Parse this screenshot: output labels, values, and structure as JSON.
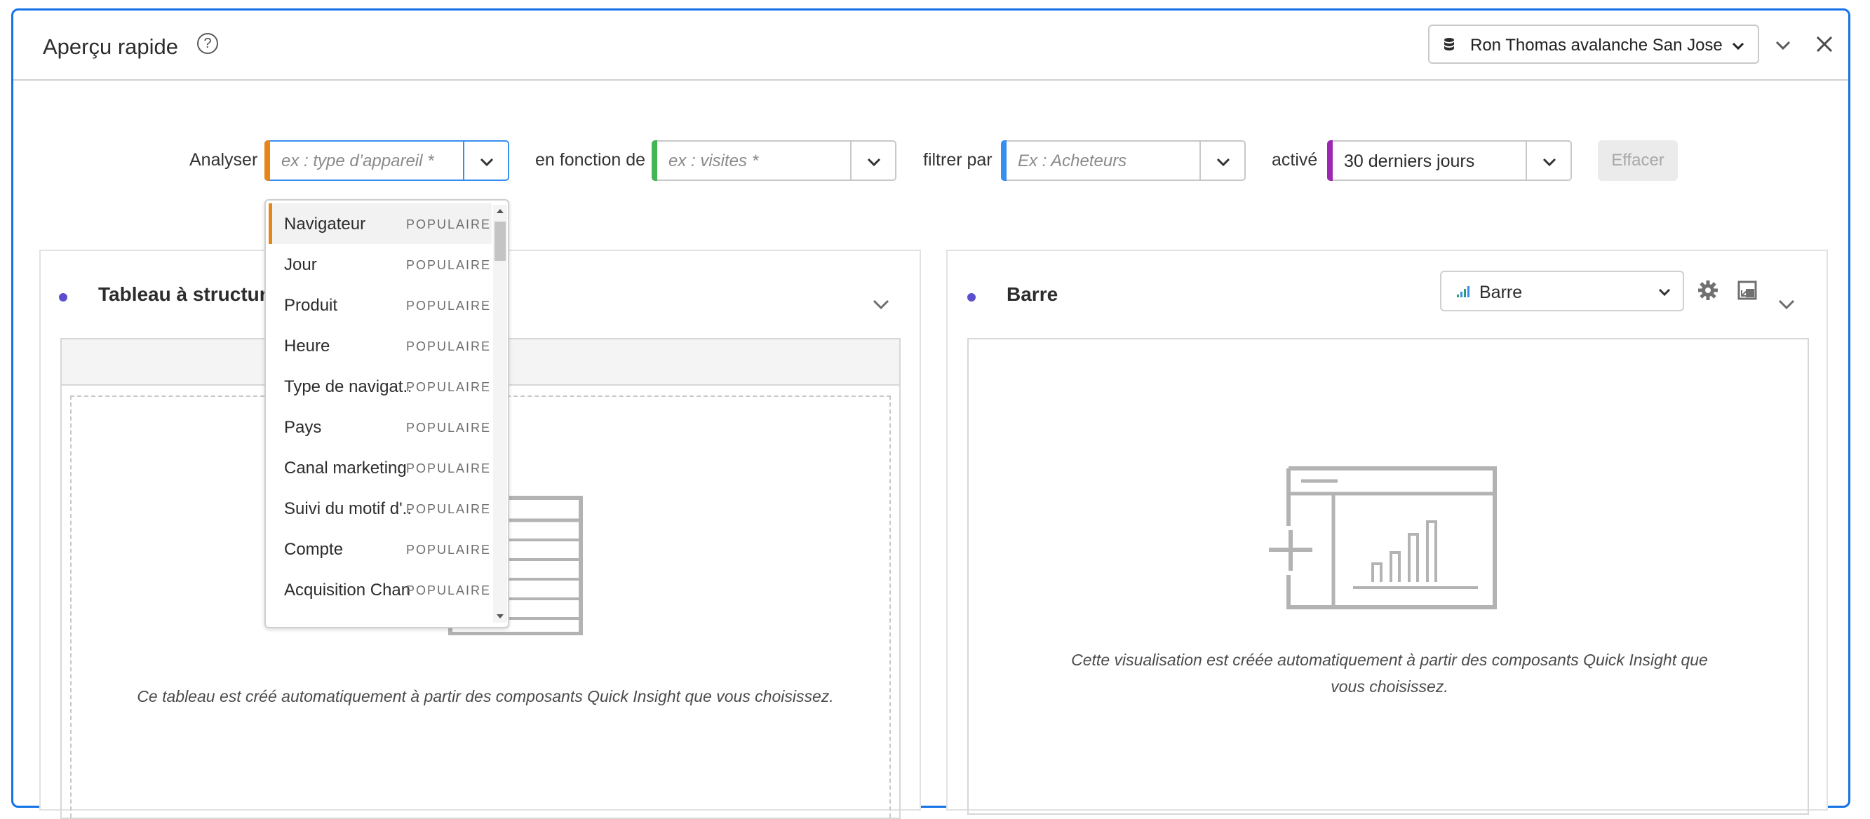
{
  "header": {
    "title": "Aperçu rapide",
    "help_glyph": "?",
    "report_suite": "Ron Thomas avalanche San Jose"
  },
  "controls": {
    "analyze_label": "Analyser",
    "analyze_placeholder": "ex : type d’appareil *",
    "analyze_color": "#e68619",
    "by_label": "en fonction de",
    "by_placeholder": "ex : visites *",
    "by_color": "#44b556",
    "filter_label": "filtrer par",
    "filter_placeholder": "Ex : Acheteurs",
    "filter_color": "#378ef0",
    "on_label": "activé",
    "date_value": "30 derniers jours",
    "date_color": "#9c28b1",
    "clear_label": "Effacer"
  },
  "dropdown": {
    "items": [
      {
        "name": "Navigateur",
        "tag": "POPULAIRE"
      },
      {
        "name": "Jour",
        "tag": "POPULAIRE"
      },
      {
        "name": "Produit",
        "tag": "POPULAIRE"
      },
      {
        "name": "Heure",
        "tag": "POPULAIRE"
      },
      {
        "name": "Type de navigat...",
        "tag": "POPULAIRE"
      },
      {
        "name": "Pays",
        "tag": "POPULAIRE"
      },
      {
        "name": "Canal marketing",
        "tag": "POPULAIRE"
      },
      {
        "name": "Suivi du motif d'...",
        "tag": "POPULAIRE"
      },
      {
        "name": "Compte",
        "tag": "POPULAIRE"
      },
      {
        "name": "Acquisition Chan...",
        "tag": "POPULAIRE"
      }
    ]
  },
  "left_panel": {
    "title": "Tableau à structure libre",
    "caption": "Ce tableau est créé automatiquement à partir des composants Quick Insight que vous choisissez."
  },
  "right_panel": {
    "title": "Barre",
    "viz_type": "Barre",
    "caption_line1": "Cette visualisation est créée automatiquement à partir des composants Quick Insight que",
    "caption_line2": "vous choisissez."
  },
  "icons": {
    "help": "help-circle-icon",
    "report_suite": "database-icon",
    "collapse": "chevron-down-icon",
    "close": "close-icon",
    "settings": "gear-icon",
    "expand": "expand-icon",
    "bar_chart": "bar-chart-icon"
  }
}
